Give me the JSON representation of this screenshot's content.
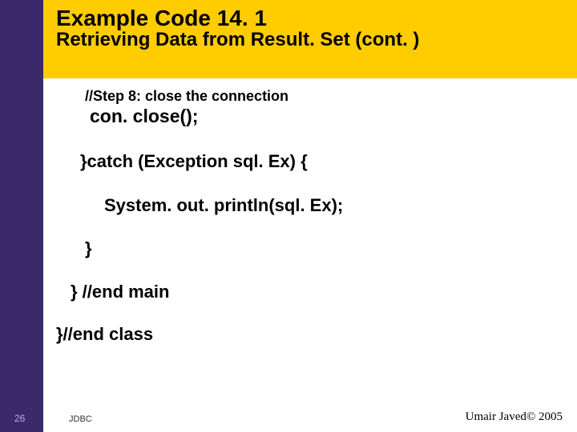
{
  "header": {
    "title": "Example Code 14. 1",
    "subtitle": "Retrieving Data from Result. Set (cont. )"
  },
  "code": {
    "step_comment": "//Step 8: close the connection",
    "con_close": "con. close();",
    "catch_line": "}catch (Exception sql. Ex) {",
    "println": "System. out. println(sql. Ex);",
    "brace_close": "}",
    "end_main": "} //end main",
    "end_class": "}//end class"
  },
  "footer": {
    "page_number": "26",
    "label": "JDBC",
    "copyright": "Umair Javed© 2005"
  }
}
